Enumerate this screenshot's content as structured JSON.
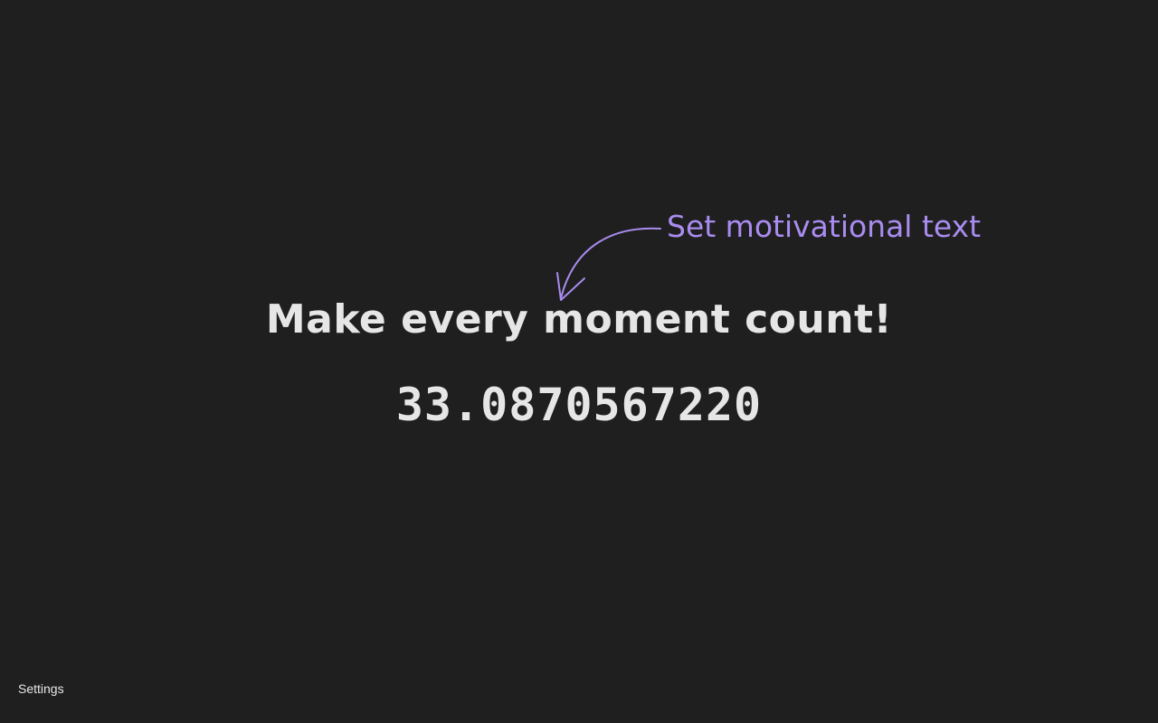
{
  "hint": {
    "text": "Set motivational text",
    "color": "#a98cf0",
    "icon": "curved-arrow-icon"
  },
  "motivation": {
    "text": "Make every moment count!"
  },
  "counter": {
    "value": "33.0870567220"
  },
  "footer": {
    "settings_label": "Settings"
  },
  "colors": {
    "background": "#1f1f1f",
    "text": "#e6e6e6",
    "accent": "#a98cf0"
  }
}
